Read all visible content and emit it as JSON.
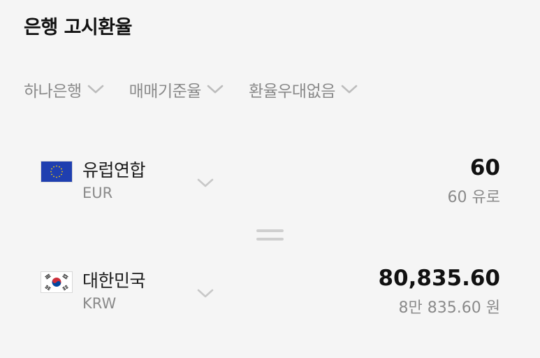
{
  "page": {
    "title": "은행 고시환율"
  },
  "filters": [
    {
      "label": "하나은행"
    },
    {
      "label": "매매기준율"
    },
    {
      "label": "환율우대없음"
    }
  ],
  "from_currency": {
    "name": "유럽연합",
    "code": "EUR",
    "amount": "60",
    "amount_text": "60 유로",
    "flag_icon": "eu-flag-icon"
  },
  "to_currency": {
    "name": "대한민국",
    "code": "KRW",
    "amount": "80,835.60",
    "amount_text": "8만 835.60 원",
    "flag_icon": "kr-flag-icon"
  },
  "colors": {
    "background": "#f5f5f5",
    "primary_text": "#111111",
    "secondary_text": "#8a8a8a",
    "chevron": "#bdbdbd",
    "eu_blue": "#1f3fb0",
    "eu_star": "#ffd400"
  }
}
